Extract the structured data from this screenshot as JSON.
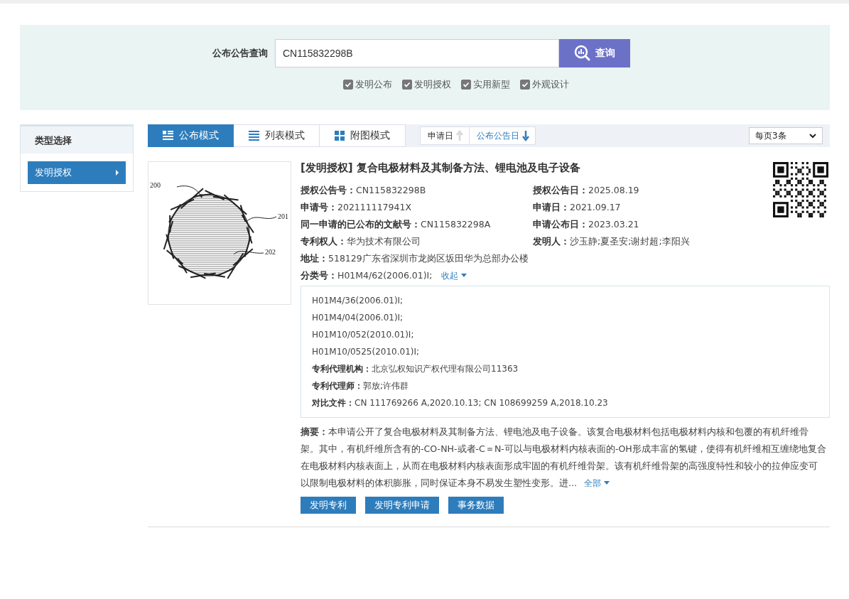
{
  "search": {
    "label": "公布公告查询",
    "value": "CN115832298B",
    "button": "查询",
    "filters": [
      {
        "label": "发明公布",
        "checked": true
      },
      {
        "label": "发明授权",
        "checked": true
      },
      {
        "label": "实用新型",
        "checked": true
      },
      {
        "label": "外观设计",
        "checked": true
      }
    ]
  },
  "sidebar": {
    "title": "类型选择",
    "items": [
      {
        "label": "发明授权",
        "selected": true
      }
    ]
  },
  "view_tabs": [
    {
      "label": "公布模式",
      "kind": "detail",
      "selected": true
    },
    {
      "label": "列表模式",
      "kind": "list",
      "selected": false
    },
    {
      "label": "附图模式",
      "kind": "grid",
      "selected": false
    }
  ],
  "sort": [
    {
      "label": "申请日",
      "selected": false
    },
    {
      "label": "公布公告日",
      "selected": true
    }
  ],
  "page_size": "每页3条",
  "result": {
    "figure_labels": [
      "200",
      "201",
      "202"
    ],
    "title": "[发明授权] 复合电极材料及其制备方法、锂电池及电子设备",
    "fields": [
      {
        "label": "授权公告号：",
        "value": "CN115832298B"
      },
      {
        "label": "授权公告日：",
        "value": "2025.08.19"
      },
      {
        "label": "申请号：",
        "value": "202111117941X"
      },
      {
        "label": "申请日：",
        "value": "2021.09.17"
      },
      {
        "label": "同一申请的已公布的文献号：",
        "value": "CN115832298A"
      },
      {
        "label": "申请公布日：",
        "value": "2023.03.21"
      },
      {
        "label": "专利权人：",
        "value": "华为技术有限公司"
      },
      {
        "label": "发明人：",
        "value": "沙玉静;夏圣安;谢封超;李阳兴"
      }
    ],
    "address": {
      "label": "地址：",
      "value": "518129广东省深圳市龙岗区坂田华为总部办公楼"
    },
    "classification": {
      "label": "分类号：",
      "value": "H01M4/62(2006.01)I;",
      "toggle": "收起",
      "expanded": true
    },
    "details": [
      {
        "value": "H01M4/36(2006.01)I;"
      },
      {
        "value": "H01M4/04(2006.01)I;"
      },
      {
        "value": "H01M10/052(2010.01)I;"
      },
      {
        "value": "H01M10/0525(2010.01)I;"
      },
      {
        "label": "专利代理机构：",
        "value": "北京弘权知识产权代理有限公司11363"
      },
      {
        "label": "专利代理师：",
        "value": "郭放;许伟群"
      },
      {
        "label": "对比文件：",
        "value": "CN 111769266 A,2020.10.13; CN 108699259 A,2018.10.23"
      }
    ],
    "abstract": {
      "text": "**摘要：**本申请公开了复合电极材料及其制备方法、锂电池及电子设备。该复合电极材料包括电极材料内核和包覆的有机纤维骨架。其中，有机纤维所含有的-CO-NH-或者-C＝N-可以与电极材料内核表面的-OH形成丰富的氢键，使得有机纤维相互缠绕地复合在电极材料内核表面上，从而在电极材料内核表面形成牢固的有机纤维骨架。该有机纤维骨架的高强度特性和较小的拉伸应变可以限制电极材料的体积膨胀，同时保证本身不易发生塑性变形。进...",
      "more": "全部"
    },
    "buttons": [
      "发明专利",
      "发明专利申请",
      "事务数据"
    ]
  }
}
